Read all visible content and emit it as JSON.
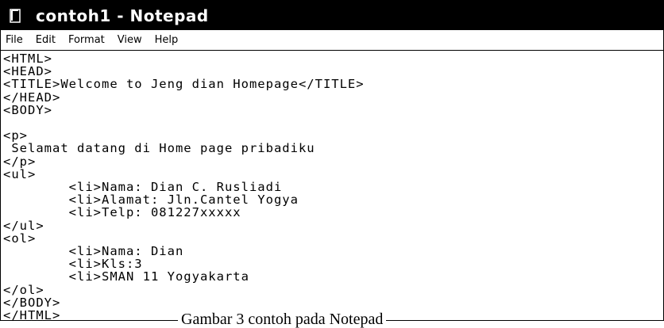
{
  "window": {
    "title": "contoh1 - Notepad",
    "app_icon": "notepad-icon"
  },
  "menu": {
    "items": [
      "File",
      "Edit",
      "Format",
      "View",
      "Help"
    ]
  },
  "editor": {
    "lines": [
      "<HTML>",
      "<HEAD>",
      "<TITLE>Welcome to Jeng dian Homepage</TITLE>",
      "</HEAD>",
      "<BODY>",
      "",
      "<p>",
      " Selamat datang di Home page pribadiku",
      "</p>",
      "<ul>",
      "        <li>Nama: Dian C. Rusliadi",
      "        <li>Alamat: Jln.Cantel Yogya",
      "        <li>Telp: 081227xxxxx",
      "</ul>",
      "<ol>",
      "        <li>Nama: Dian",
      "        <li>Kls:3",
      "        <li>SMAN 11 Yogyakarta",
      "</ol>",
      "</BODY>",
      "</HTML>"
    ]
  },
  "caption": {
    "text": "Gambar 3 contoh pada Notepad"
  }
}
